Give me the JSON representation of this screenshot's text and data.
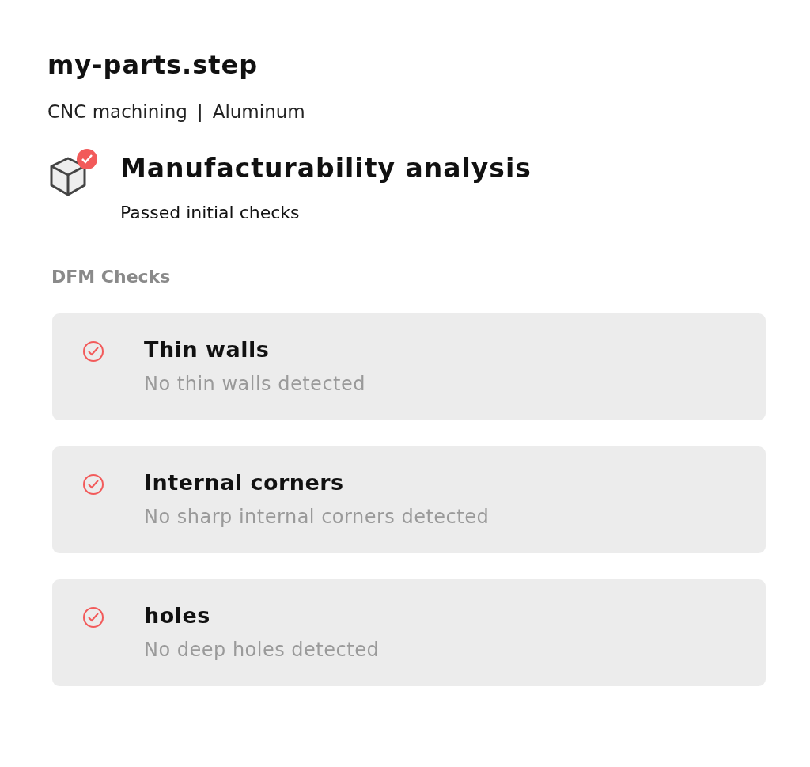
{
  "file": {
    "name": "my-parts.step",
    "process": "CNC machining",
    "separator": "|",
    "material": "Aluminum"
  },
  "analysis": {
    "title": "Manufacturability analysis",
    "summary": "Passed initial checks",
    "passed": true
  },
  "section_title": "DFM Checks",
  "checks": [
    {
      "title": "Thin walls",
      "detail": "No thin walls detected",
      "passed": true
    },
    {
      "title": "Internal corners",
      "detail": "No sharp internal corners detected",
      "passed": true
    },
    {
      "title": "holes",
      "detail": "No deep holes detected",
      "passed": true
    }
  ]
}
